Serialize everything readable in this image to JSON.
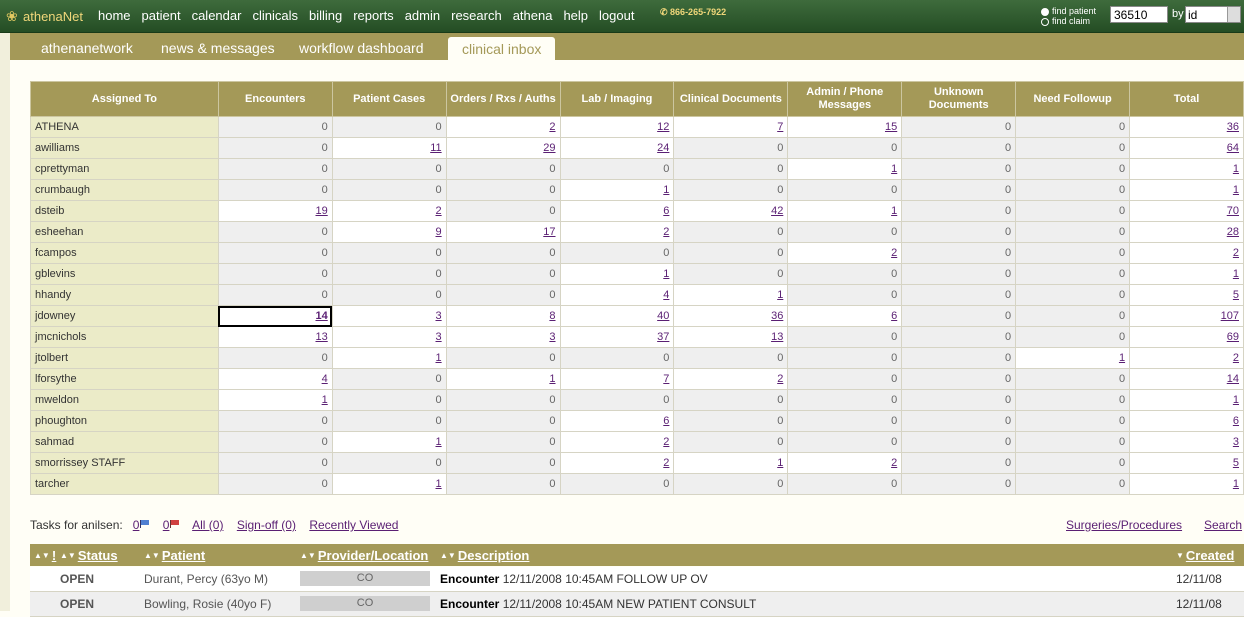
{
  "app": {
    "logo_text": "athenaNet"
  },
  "nav": [
    "home",
    "patient",
    "calendar",
    "clinicals",
    "billing",
    "reports",
    "admin",
    "research",
    "athena",
    "help",
    "logout"
  ],
  "phone": "866-265-7922",
  "finder": {
    "option1": "find patient",
    "option2": "find claim",
    "input_value": "36510",
    "by_label": "by",
    "by_value": "id"
  },
  "tabs": [
    "athenanetwork",
    "news & messages",
    "workflow dashboard",
    "clinical inbox"
  ],
  "inbox": {
    "columns": [
      "Assigned To",
      "Encounters",
      "Patient Cases",
      "Orders / Rxs / Auths",
      "Lab / Imaging",
      "Clinical Documents",
      "Admin / Phone Messages",
      "Unknown Documents",
      "Need Followup",
      "Total"
    ],
    "rows": [
      {
        "name": "ATHENA",
        "values": [
          "0",
          "0",
          "2",
          "12",
          "7",
          "15",
          "0",
          "0",
          "36"
        ]
      },
      {
        "name": "awilliams",
        "values": [
          "0",
          "11",
          "29",
          "24",
          "0",
          "0",
          "0",
          "0",
          "64"
        ]
      },
      {
        "name": "cprettyman",
        "values": [
          "0",
          "0",
          "0",
          "0",
          "0",
          "1",
          "0",
          "0",
          "1"
        ]
      },
      {
        "name": "crumbaugh",
        "values": [
          "0",
          "0",
          "0",
          "1",
          "0",
          "0",
          "0",
          "0",
          "1"
        ]
      },
      {
        "name": "dsteib",
        "values": [
          "19",
          "2",
          "0",
          "6",
          "42",
          "1",
          "0",
          "0",
          "70"
        ]
      },
      {
        "name": "esheehan",
        "values": [
          "0",
          "9",
          "17",
          "2",
          "0",
          "0",
          "0",
          "0",
          "28"
        ]
      },
      {
        "name": "fcampos",
        "values": [
          "0",
          "0",
          "0",
          "0",
          "0",
          "2",
          "0",
          "0",
          "2"
        ]
      },
      {
        "name": "gblevins",
        "values": [
          "0",
          "0",
          "0",
          "1",
          "0",
          "0",
          "0",
          "0",
          "1"
        ]
      },
      {
        "name": "hhandy",
        "values": [
          "0",
          "0",
          "0",
          "4",
          "1",
          "0",
          "0",
          "0",
          "5"
        ]
      },
      {
        "name": "jdowney",
        "values": [
          "14",
          "3",
          "8",
          "40",
          "36",
          "6",
          "0",
          "0",
          "107"
        ]
      },
      {
        "name": "jmcnichols",
        "values": [
          "13",
          "3",
          "3",
          "37",
          "13",
          "0",
          "0",
          "0",
          "69"
        ]
      },
      {
        "name": "jtolbert",
        "values": [
          "0",
          "1",
          "0",
          "0",
          "0",
          "0",
          "0",
          "1",
          "2"
        ]
      },
      {
        "name": "lforsythe",
        "values": [
          "4",
          "0",
          "1",
          "7",
          "2",
          "0",
          "0",
          "0",
          "14"
        ]
      },
      {
        "name": "mweldon",
        "values": [
          "1",
          "0",
          "0",
          "0",
          "0",
          "0",
          "0",
          "0",
          "1"
        ]
      },
      {
        "name": "phoughton",
        "values": [
          "0",
          "0",
          "0",
          "6",
          "0",
          "0",
          "0",
          "0",
          "6"
        ]
      },
      {
        "name": "sahmad",
        "values": [
          "0",
          "1",
          "0",
          "2",
          "0",
          "0",
          "0",
          "0",
          "3"
        ]
      },
      {
        "name": "smorrissey STAFF",
        "values": [
          "0",
          "0",
          "0",
          "2",
          "1",
          "2",
          "0",
          "0",
          "5"
        ]
      },
      {
        "name": "tarcher",
        "values": [
          "0",
          "1",
          "0",
          "0",
          "0",
          "0",
          "0",
          "0",
          "1"
        ]
      }
    ]
  },
  "tasks": {
    "label": "Tasks for anilsen:",
    "blue_count": "0",
    "red_count": "0",
    "all": "All (0)",
    "signoff": "Sign-off (0)",
    "recent": "Recently Viewed",
    "surgeries": "Surgeries/Procedures",
    "search": "Search"
  },
  "list": {
    "headers": {
      "bang": "!",
      "status": "Status",
      "patient": "Patient",
      "provider": "Provider/Location",
      "description": "Description",
      "created": "Created"
    },
    "rows": [
      {
        "status": "OPEN",
        "patient": "Durant, Percy (63yo M)",
        "location": "CO",
        "type": "Encounter",
        "desc": "12/11/2008 10:45AM FOLLOW UP OV",
        "created": "12/11/08"
      },
      {
        "status": "OPEN",
        "patient": "Bowling, Rosie (40yo F)",
        "location": "CO",
        "type": "Encounter",
        "desc": "12/11/2008 10:45AM NEW PATIENT CONSULT",
        "created": "12/11/08"
      }
    ]
  },
  "colors": {
    "header_green": "#244d24",
    "olive": "#a49958",
    "link": "#5a1f73"
  }
}
